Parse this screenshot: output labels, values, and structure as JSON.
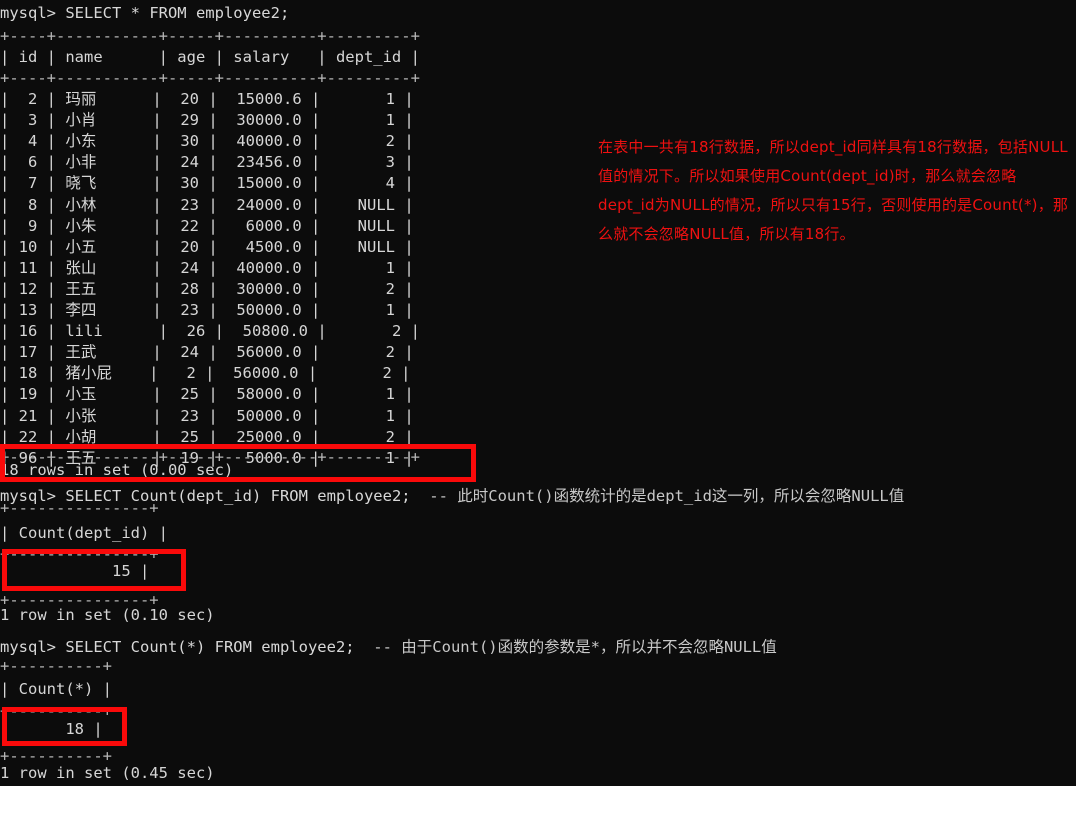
{
  "terminal": {
    "prompt": "mysql> ",
    "queries": {
      "select_all": "SELECT * FROM employee2;",
      "count_dept": "SELECT Count(dept_id) FROM employee2;",
      "count_star": "SELECT Count(*) FROM employee2;"
    },
    "comments": {
      "count_dept": "-- 此时Count()函数统计的是dept_id这一列，所以会忽略NULL值",
      "count_star": "-- 由于Count()函数的参数是*，所以并不会忽略NULL值"
    },
    "rule_main": "+----+-----------+-----+----------+---------+",
    "header_main": "| id | name      | age | salary   | dept_id |",
    "columns": [
      "id",
      "name",
      "age",
      "salary",
      "dept_id"
    ],
    "rows": [
      {
        "id": "2",
        "name": "玛丽",
        "age": "20",
        "salary": "15000.6",
        "dept_id": "1"
      },
      {
        "id": "3",
        "name": "小肖",
        "age": "29",
        "salary": "30000.0",
        "dept_id": "1"
      },
      {
        "id": "4",
        "name": "小东",
        "age": "30",
        "salary": "40000.0",
        "dept_id": "2"
      },
      {
        "id": "6",
        "name": "小非",
        "age": "24",
        "salary": "23456.0",
        "dept_id": "3"
      },
      {
        "id": "7",
        "name": "晓飞",
        "age": "30",
        "salary": "15000.0",
        "dept_id": "4"
      },
      {
        "id": "8",
        "name": "小林",
        "age": "23",
        "salary": "24000.0",
        "dept_id": "NULL"
      },
      {
        "id": "9",
        "name": "小朱",
        "age": "22",
        "salary": "6000.0",
        "dept_id": "NULL"
      },
      {
        "id": "10",
        "name": "小五",
        "age": "20",
        "salary": "4500.0",
        "dept_id": "NULL"
      },
      {
        "id": "11",
        "name": "张山",
        "age": "24",
        "salary": "40000.0",
        "dept_id": "1"
      },
      {
        "id": "12",
        "name": "王五",
        "age": "28",
        "salary": "30000.0",
        "dept_id": "2"
      },
      {
        "id": "13",
        "name": "李四",
        "age": "23",
        "salary": "50000.0",
        "dept_id": "1"
      },
      {
        "id": "16",
        "name": "lili",
        "age": "26",
        "salary": "50800.0",
        "dept_id": "2"
      },
      {
        "id": "17",
        "name": "王武",
        "age": "24",
        "salary": "56000.0",
        "dept_id": "2"
      },
      {
        "id": "18",
        "name": "猪小屁",
        "age": "2",
        "salary": "56000.0",
        "dept_id": "2"
      },
      {
        "id": "19",
        "name": "小玉",
        "age": "25",
        "salary": "58000.0",
        "dept_id": "1"
      },
      {
        "id": "21",
        "name": "小张",
        "age": "23",
        "salary": "50000.0",
        "dept_id": "1"
      },
      {
        "id": "22",
        "name": "小胡",
        "age": "25",
        "salary": "25000.0",
        "dept_id": "2"
      },
      {
        "id": "96",
        "name": "王五",
        "age": "19",
        "salary": "5000.0",
        "dept_id": "1"
      }
    ],
    "status_rows18": "18 rows in set (0.00 sec)",
    "count_dept_table": {
      "rule": "+---------------+",
      "header": "| Count(dept_id) |",
      "header_label": "Count(dept_id)",
      "value": "15",
      "status": "1 row in set (0.10 sec)"
    },
    "count_star_table": {
      "rule": "+----------+",
      "header": "| Count(*) |",
      "header_label": "Count(*)",
      "value": "18",
      "status": "1 row in set (0.45 sec)"
    }
  },
  "annotation": {
    "text": "在表中一共有18行数据，所以dept_id同样具有18行数据，包括NULL值的情况下。所以如果使用Count(dept_id)时，那么就会忽略dept_id为NULL的情况，所以只有15行，否则使用的是Count(*)，那么就不会忽略NULL值，所以有18行。",
    "color": "#ee1111"
  },
  "highlights": {
    "rows_box_label": "18 rows in set (0.00 sec)",
    "count_dept_box_label": "15",
    "count_star_box_label": "18",
    "color": "#fa0a0a"
  }
}
